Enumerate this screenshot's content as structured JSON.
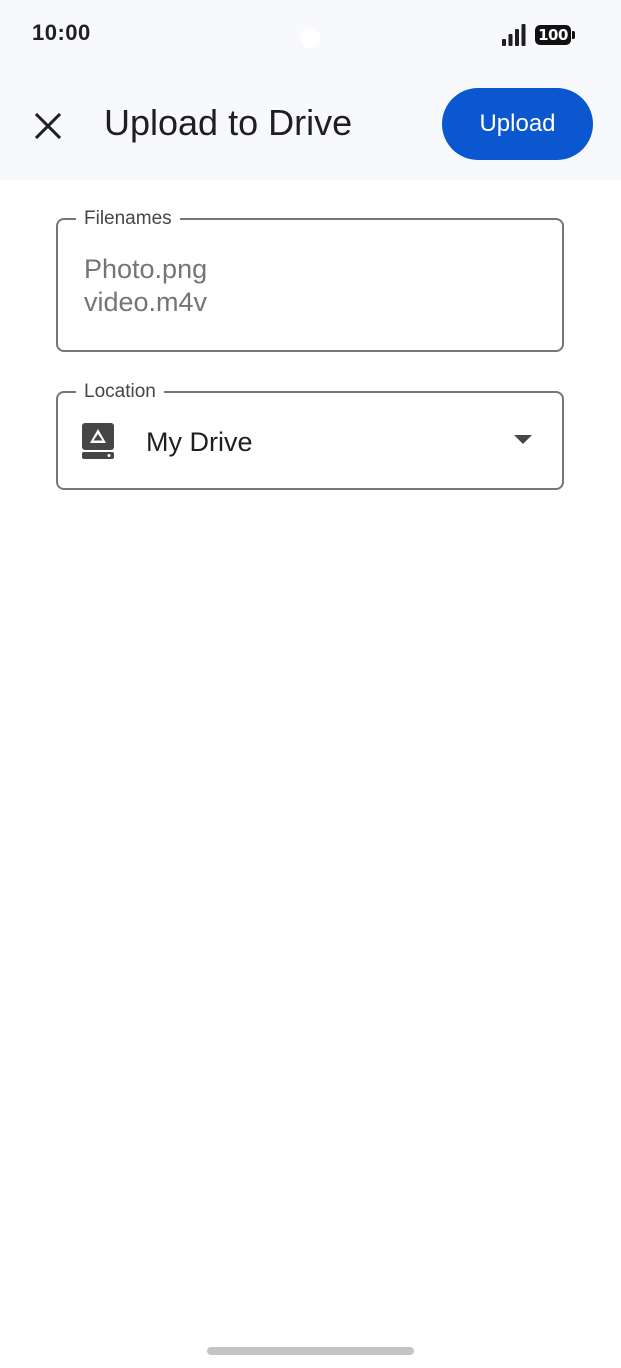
{
  "status_bar": {
    "time": "10:00",
    "battery_level": "100",
    "icons": [
      "signal-icon",
      "battery-icon"
    ]
  },
  "app_bar": {
    "close_icon": "close-icon",
    "title": "Upload to Drive",
    "upload_label": "Upload",
    "accent_color": "#0b57d0"
  },
  "filenames": {
    "label": "Filenames",
    "values": [
      "Photo.png",
      "video.m4v"
    ]
  },
  "location": {
    "label": "Location",
    "icon": "drive-icon",
    "value": "My Drive",
    "dropdown_icon": "dropdown-arrow-icon"
  }
}
